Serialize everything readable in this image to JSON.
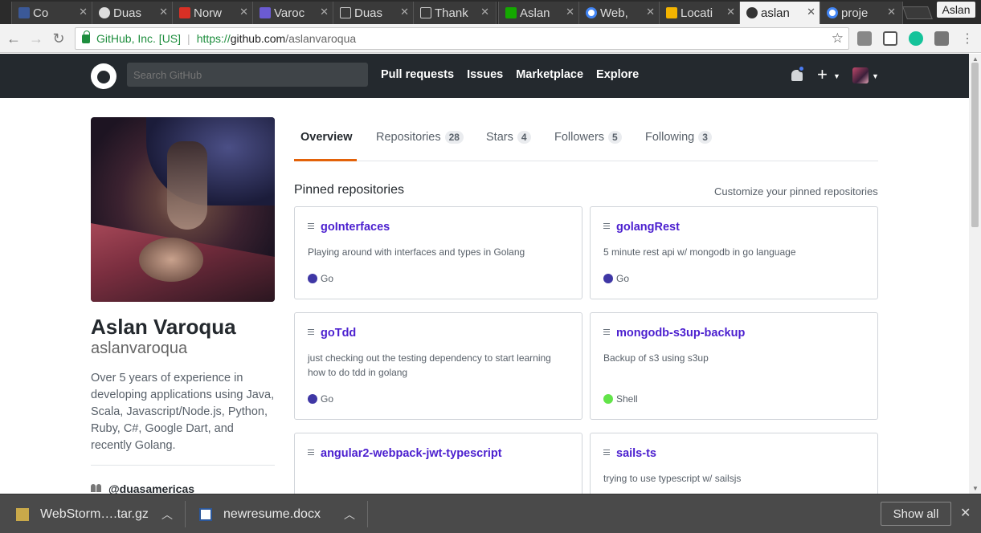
{
  "browser": {
    "tabs": [
      {
        "label": "Co",
        "color": "#3b5998"
      },
      {
        "label": "Duas",
        "color": "#333333"
      },
      {
        "label": "Norw",
        "color": "#d93025"
      },
      {
        "label": "Varoc",
        "color": "#6b5bd3"
      },
      {
        "label": "Duas",
        "color": "#eeeeee"
      },
      {
        "label": "Thank",
        "color": "#eeeeee"
      },
      {
        "label": "Aslan",
        "color": "#14a800"
      },
      {
        "label": "Web,",
        "color": "#4285f4"
      },
      {
        "label": "Locati",
        "color": "#f4b400"
      },
      {
        "label": "aslan",
        "color": "#333333"
      },
      {
        "label": "proje",
        "color": "#4285f4"
      }
    ],
    "profile_name": "Aslan",
    "secure_label": "GitHub, Inc. [US]",
    "url_scheme": "https://",
    "url_host": "github.com",
    "url_path": "/aslanvaroqua"
  },
  "github_header": {
    "search_placeholder": "Search GitHub",
    "nav": [
      "Pull requests",
      "Issues",
      "Marketplace",
      "Explore"
    ],
    "plus_label": "+"
  },
  "profile": {
    "name": "Aslan Varoqua",
    "login": "aslanvaroqua",
    "bio": "Over 5 years of experience in developing applications using Java, Scala, Javascript/Node.js, Python, Ruby, C#, Google Dart, and recently Golang.",
    "org": "@duasamericas"
  },
  "tabs": {
    "overview": "Overview",
    "repositories": "Repositories",
    "repositories_count": "28",
    "stars": "Stars",
    "stars_count": "4",
    "followers": "Followers",
    "followers_count": "5",
    "following": "Following",
    "following_count": "3"
  },
  "pinned": {
    "title": "Pinned repositories",
    "customize": "Customize your pinned repositories",
    "repos": [
      {
        "name": "goInterfaces",
        "desc": "Playing around with interfaces and types in Golang",
        "lang": "Go",
        "lang_color": "#3f37a5"
      },
      {
        "name": "golangRest",
        "desc": "5 minute rest api w/ mongodb in go language",
        "lang": "Go",
        "lang_color": "#3f37a5"
      },
      {
        "name": "goTdd",
        "desc": "just checking out the testing dependency to start learning how to do tdd in golang",
        "lang": "Go",
        "lang_color": "#3f37a5"
      },
      {
        "name": "mongodb-s3up-backup",
        "desc": "Backup of s3 using s3up",
        "lang": "Shell",
        "lang_color": "#62e449"
      },
      {
        "name": "angular2-webpack-jwt-typescript",
        "desc": "",
        "lang": "",
        "lang_color": ""
      },
      {
        "name": "sails-ts",
        "desc": "trying to use typescript w/ sailsjs",
        "lang": "",
        "lang_color": ""
      }
    ]
  },
  "downloads": {
    "items": [
      "WebStorm….tar.gz",
      "newresume.docx"
    ],
    "show_all": "Show all"
  }
}
